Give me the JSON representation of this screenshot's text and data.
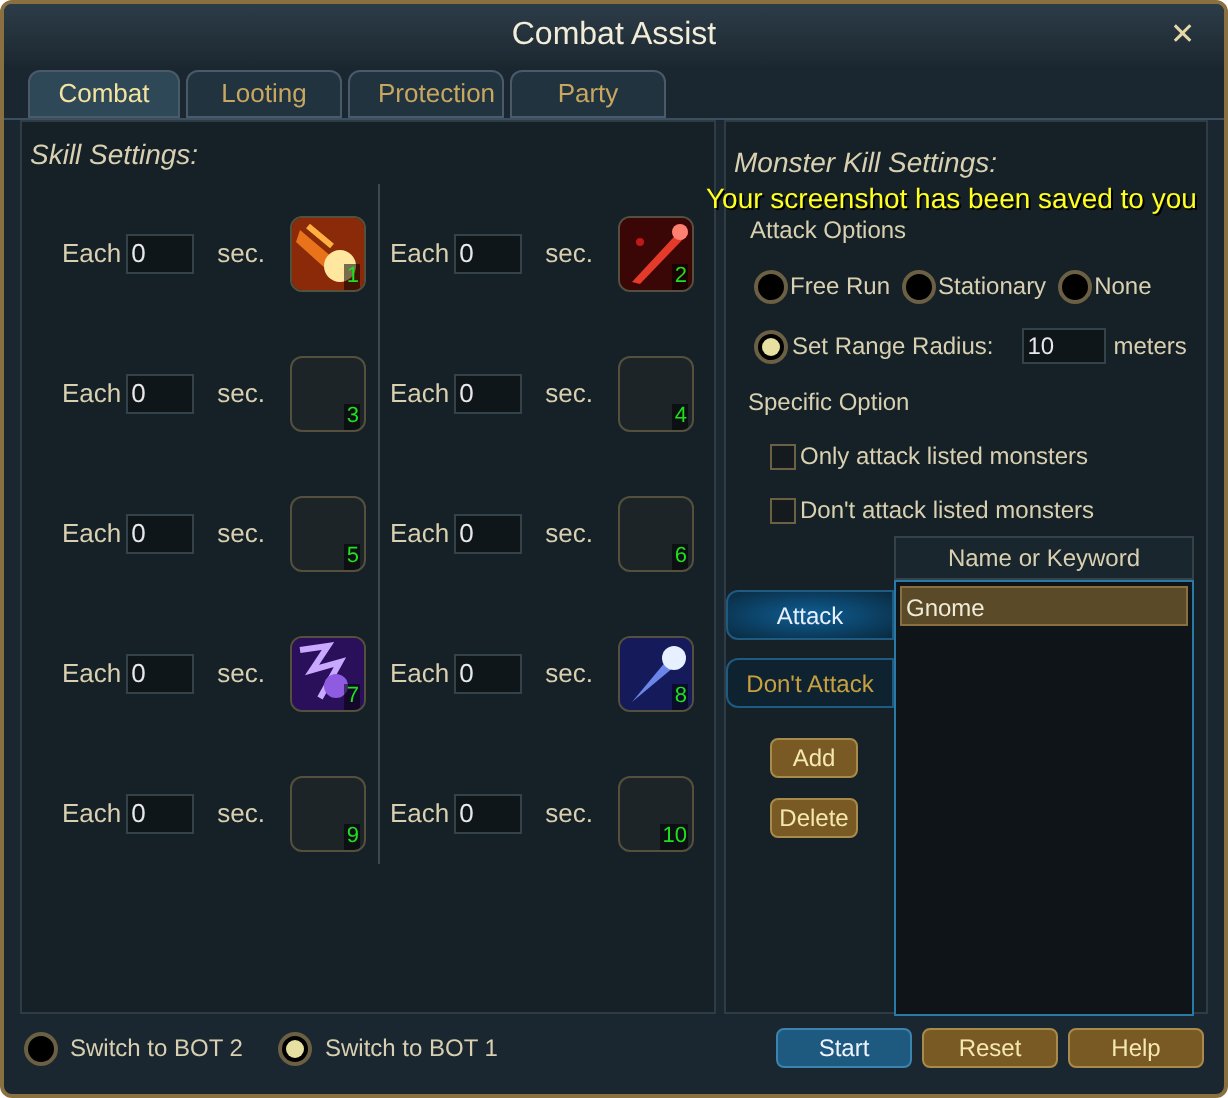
{
  "window": {
    "title": "Combat Assist",
    "close": "✕"
  },
  "tabs": [
    {
      "label": "Combat",
      "selected": true
    },
    {
      "label": "Looting",
      "selected": false
    },
    {
      "label": "Protection",
      "selected": false
    },
    {
      "label": "Party",
      "selected": false
    }
  ],
  "skill_settings": {
    "title": "Skill Settings:",
    "slots": [
      {
        "prefix": "Each",
        "value": "0",
        "unit": "sec.",
        "kind": "fire",
        "number": "1"
      },
      {
        "prefix": "Each",
        "value": "0",
        "unit": "sec.",
        "kind": "blood",
        "number": "2"
      },
      {
        "prefix": "Each",
        "value": "0",
        "unit": "sec.",
        "kind": "empty",
        "number": "3"
      },
      {
        "prefix": "Each",
        "value": "0",
        "unit": "sec.",
        "kind": "empty",
        "number": "4"
      },
      {
        "prefix": "Each",
        "value": "0",
        "unit": "sec.",
        "kind": "empty",
        "number": "5"
      },
      {
        "prefix": "Each",
        "value": "0",
        "unit": "sec.",
        "kind": "empty",
        "number": "6"
      },
      {
        "prefix": "Each",
        "value": "0",
        "unit": "sec.",
        "kind": "shadow",
        "number": "7"
      },
      {
        "prefix": "Each",
        "value": "0",
        "unit": "sec.",
        "kind": "frost",
        "number": "8"
      },
      {
        "prefix": "Each",
        "value": "0",
        "unit": "sec.",
        "kind": "empty",
        "number": "9"
      },
      {
        "prefix": "Each",
        "value": "0",
        "unit": "sec.",
        "kind": "empty",
        "number": "10"
      }
    ]
  },
  "monster_kill": {
    "title": "Monster Kill Settings:",
    "attack_options_label": "Attack Options",
    "modes": [
      {
        "label": "Free Run",
        "selected": false
      },
      {
        "label": "Stationary",
        "selected": false
      },
      {
        "label": "None",
        "selected": false
      }
    ],
    "range": {
      "label": "Set Range Radius:",
      "selected": true,
      "value": "10",
      "unit": "meters"
    },
    "specific_label": "Specific Option",
    "checks": [
      {
        "label": "Only attack listed monsters",
        "checked": false
      },
      {
        "label": "Don't attack listed monsters",
        "checked": false
      }
    ],
    "list_tabs": [
      {
        "label": "Attack",
        "selected": true
      },
      {
        "label": "Don't Attack",
        "selected": false
      }
    ],
    "add": "Add",
    "delete": "Delete",
    "list_header": "Name or Keyword",
    "list_items": [
      {
        "label": "Gnome",
        "selected": true
      }
    ]
  },
  "notification": "Your screenshot has been saved to you",
  "bot_switch": [
    {
      "label": "Switch to BOT 2",
      "selected": false
    },
    {
      "label": "Switch to BOT 1",
      "selected": true
    }
  ],
  "buttons": [
    {
      "label": "Start",
      "kind": "primary"
    },
    {
      "label": "Reset",
      "kind": "secondary"
    },
    {
      "label": "Help",
      "kind": "secondary"
    }
  ]
}
